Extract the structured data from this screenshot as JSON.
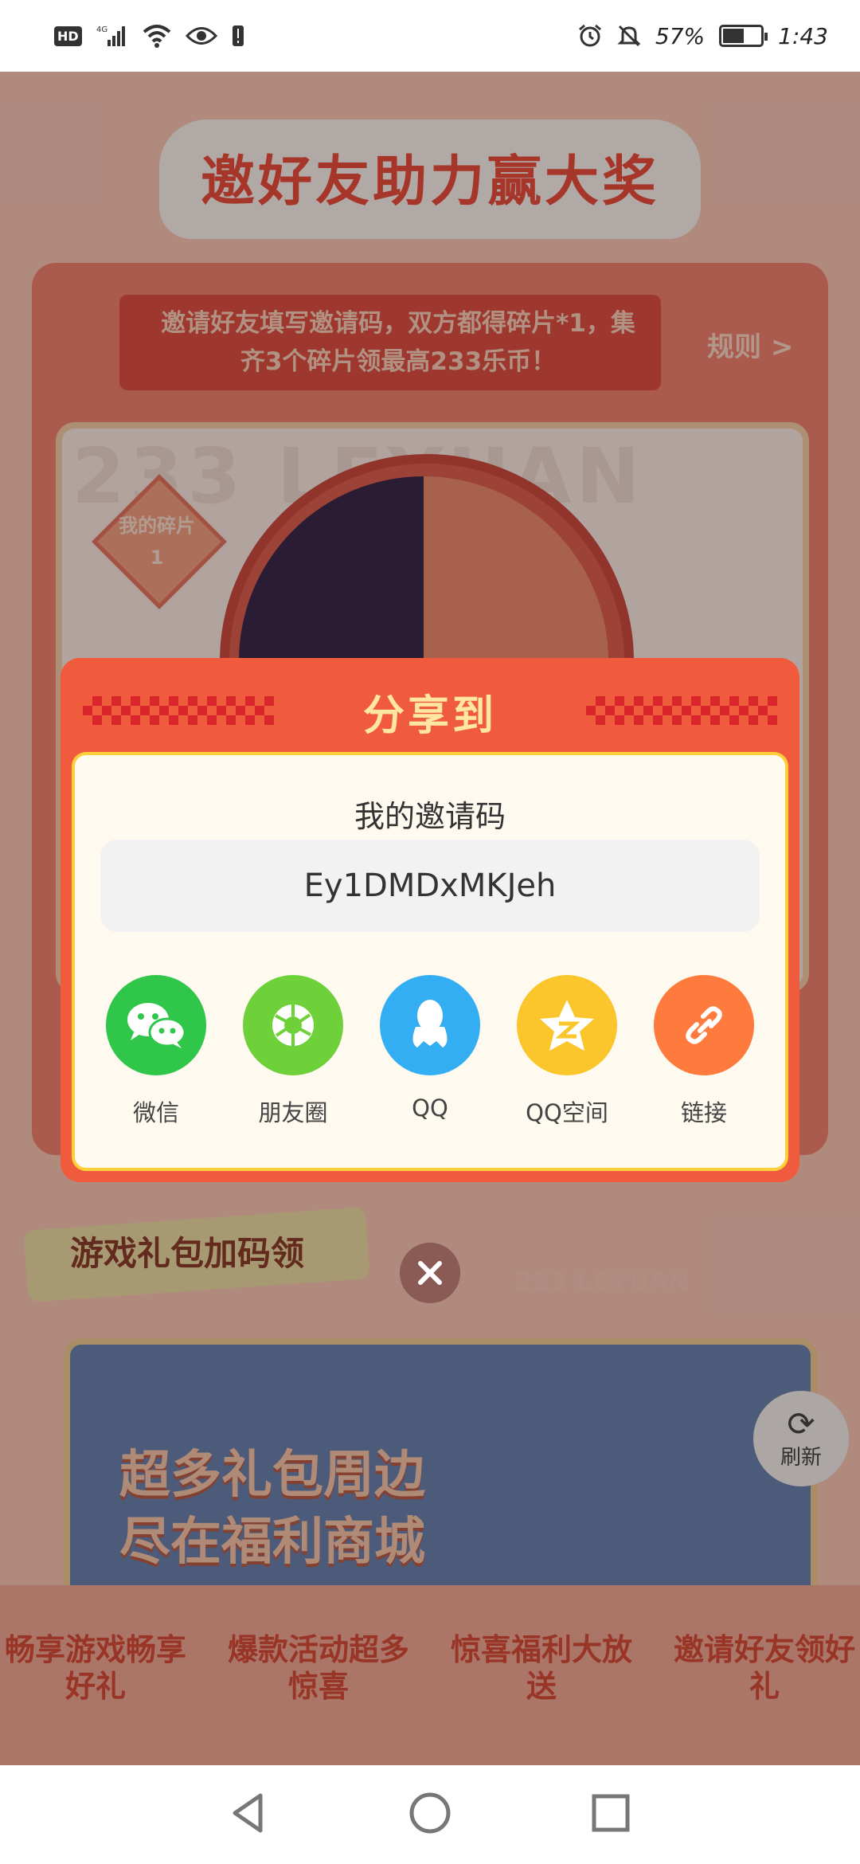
{
  "status_bar": {
    "hd": "HD",
    "network": "4G",
    "battery_text": "57%",
    "battery_level": 0.57,
    "time": "1:43"
  },
  "background": {
    "title": "邀好友助力赢大奖",
    "invite_text": "邀请好友填写邀请码，双方都得碎片*1，集齐3个碎片领最高233乐币！",
    "rules": "规则 >",
    "watermark": "233 LEYUAN",
    "fragment_label": "我的碎片",
    "fragment_count": "1",
    "section_title": "游戏礼包加码领",
    "brand": "233 LEYUAN",
    "banner_text": "超多礼包周边尽在福利商城",
    "refresh": "刷新",
    "promos": [
      "畅享游戏畅享好礼",
      "爆款活动超多惊喜",
      "惊喜福利大放送",
      "邀请好友领好礼"
    ]
  },
  "dialog": {
    "title": "分享到",
    "code_label": "我的邀请码",
    "code": "Ey1DMDxMKJeh",
    "share_options": [
      {
        "label": "微信",
        "icon": "wechat-icon",
        "color": "#2fc64a"
      },
      {
        "label": "朋友圈",
        "icon": "moments-icon",
        "color": "#6fd13a"
      },
      {
        "label": "QQ",
        "icon": "qq-icon",
        "color": "#34aef3"
      },
      {
        "label": "QQ空间",
        "icon": "qzone-icon",
        "color": "#fbc52c"
      },
      {
        "label": "链接",
        "icon": "link-icon",
        "color": "#ff7a3d"
      }
    ]
  },
  "colors": {
    "dialog_red": "#f15b3d",
    "dialog_title": "#ffe7a3",
    "dialog_border": "#ffcf3a"
  }
}
